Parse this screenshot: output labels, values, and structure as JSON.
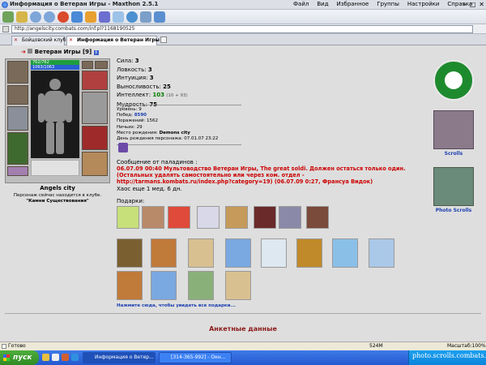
{
  "window": {
    "title": "Информация о Ветеран Игры - Maxthon 2.5.1",
    "menu": [
      "Файл",
      "Вид",
      "Избранное",
      "Группы",
      "Настройки",
      "Справка"
    ]
  },
  "address": {
    "url": "http://angelscity.combats.com/inf.pl?1168190525"
  },
  "tabs": [
    {
      "label": "Бойцовский клуб",
      "active": false
    },
    {
      "label": "Информация о Ветеран Игры",
      "active": true
    }
  ],
  "character": {
    "name": "Ветеран Игры",
    "level": "[9]",
    "hp": "762/762",
    "mana": "1063/1063",
    "city": "Angels city",
    "location_note": "Персонаж сейчас находится в клубе.",
    "location_place": "\"Камни Существования\""
  },
  "stats": {
    "strength": {
      "label": "Сила:",
      "value": "3"
    },
    "agility": {
      "label": "Ловкость:",
      "value": "3"
    },
    "intuition": {
      "label": "Интуиция:",
      "value": "3"
    },
    "endurance": {
      "label": "Выносливость:",
      "value": "25"
    },
    "intellect": {
      "label": "Интеллект:",
      "value": "103",
      "extra": "(10 + 93)"
    },
    "wisdom": {
      "label": "Мудрость:",
      "value": "75"
    }
  },
  "info": {
    "level": "Уровень: 9",
    "wins_label": "Побед:",
    "wins_value": "8590",
    "losses": "Поражений: 1562",
    "draws": "Ничьих: 29",
    "birthplace_label": "Место рождения:",
    "birthplace_value": "Demons city",
    "birthday": "День рождения персонажа: 07.01.07 23:22"
  },
  "paladin": {
    "header": "Сообщение от паладинов :",
    "line1": "06.07.09 00:40 Мультоводство Ветеран Игры, The great soldi. Должен остаться только один.",
    "line2": "(Остальных удалять самостоятельно или через ком. отдел -",
    "line3": "http://tarmans.kombats.ru/index.php?category=19) (06.07.09 0:27, Франсуа Видок)",
    "chaos": "Хаос еще 1 мед. 6 дн."
  },
  "gifts": {
    "label": "Подарки:",
    "more_link": "Нажмите сюда, чтобы увидеть все подарки..."
  },
  "profile_header": "Анкетные данные",
  "sidebar": {
    "scrolls": "Scrolls",
    "photo_scrolls": "Photo Scrolls"
  },
  "statusbar": {
    "status": "Готово",
    "memory": "524M",
    "zoom": "Масштаб:100%"
  },
  "taskbar": {
    "start": "пуск",
    "tasks": [
      "Информация о Ветер...",
      "[314-365-992] - Окн..."
    ],
    "watermark": "photo.scrolls.combats.com"
  },
  "colors": {
    "paladin_red": "#cc0000",
    "link_blue": "#1a3fb0",
    "intellect_green": "#007a00",
    "profile_header": "#8b1a1a"
  }
}
